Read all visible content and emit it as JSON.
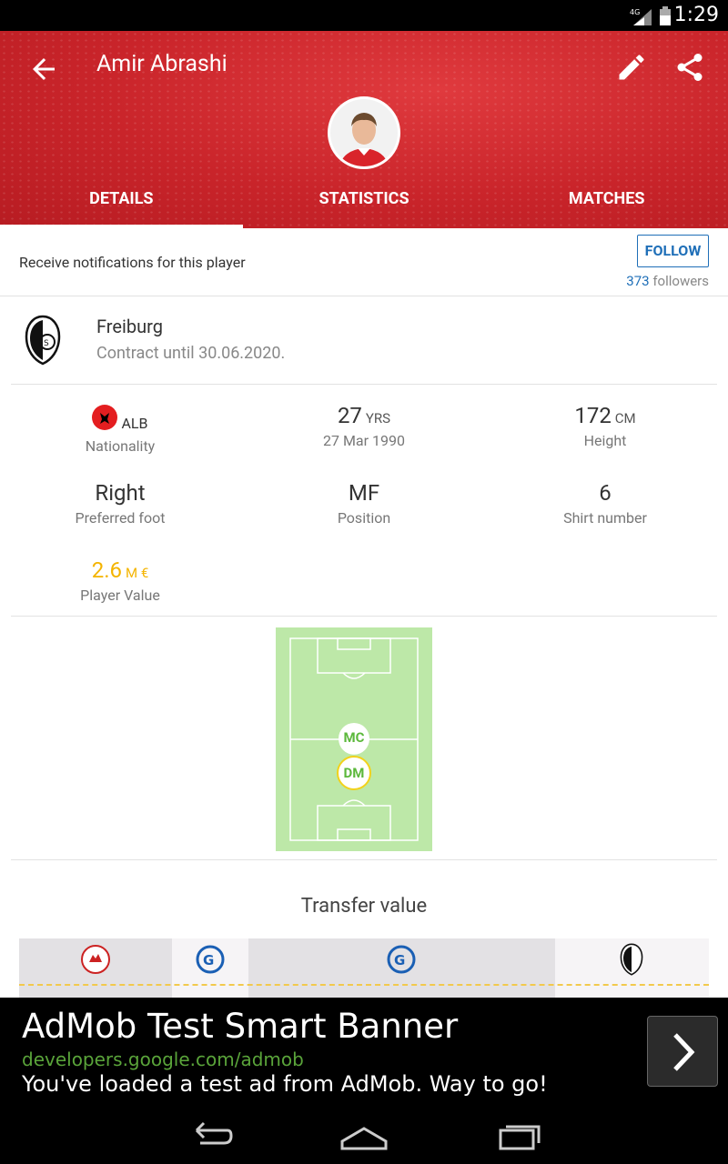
{
  "status_bar": {
    "time": "1:29",
    "network": "4G"
  },
  "header": {
    "title": "Amir Abrashi",
    "tabs": [
      {
        "label": "DETAILS",
        "active": true
      },
      {
        "label": "STATISTICS",
        "active": false
      },
      {
        "label": "MATCHES",
        "active": false
      }
    ],
    "accent_color": "#c9242a"
  },
  "notifications": {
    "text": "Receive notifications for this player",
    "follow_label": "FOLLOW",
    "followers_count": "373",
    "followers_label": "followers"
  },
  "club": {
    "name": "Freiburg",
    "contract": "Contract until 30.06.2020."
  },
  "details": {
    "nationality": {
      "value": "ALB",
      "label": "Nationality"
    },
    "age": {
      "value": "27",
      "unit": "YRS",
      "label": "27 Mar 1990"
    },
    "height": {
      "value": "172",
      "unit": "CM",
      "label": "Height"
    },
    "foot": {
      "value": "Right",
      "label": "Preferred foot"
    },
    "position": {
      "value": "MF",
      "label": "Position"
    },
    "shirt": {
      "value": "6",
      "label": "Shirt number"
    },
    "market_value": {
      "value": "2.6",
      "unit": "M €",
      "label": "Player Value",
      "color": "#f4b400"
    }
  },
  "pitch_positions": [
    {
      "code": "MC"
    },
    {
      "code": "DM"
    }
  ],
  "transfer": {
    "title": "Transfer value"
  },
  "ad": {
    "title": "AdMob Test Smart Banner",
    "url": "developers.google.com/admob",
    "text": "You've loaded a test ad from AdMob. Way to go!"
  }
}
